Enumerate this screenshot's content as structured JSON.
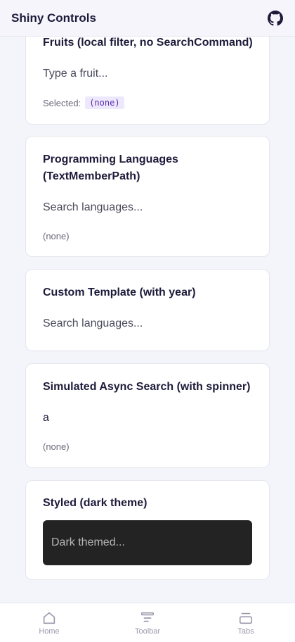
{
  "app": {
    "title": "Shiny Controls"
  },
  "cards": {
    "fruits": {
      "title": "Fruits (local filter, no SearchCommand)",
      "placeholder": "Type a fruit...",
      "selected_label": "Selected:",
      "selected_value": "(none)"
    },
    "languages": {
      "title": "Programming Languages (TextMemberPath)",
      "placeholder": "Search languages...",
      "selected_value": "(none)"
    },
    "custom": {
      "title": "Custom Template (with year)",
      "placeholder": "Search languages..."
    },
    "async": {
      "title": "Simulated Async Search (with spinner)",
      "value": "a",
      "selected_value": "(none)"
    },
    "styled": {
      "title": "Styled (dark theme)",
      "placeholder": "Dark themed..."
    }
  },
  "nav": {
    "home": "Home",
    "toolbar": "Toolbar",
    "tabs": "Tabs"
  }
}
